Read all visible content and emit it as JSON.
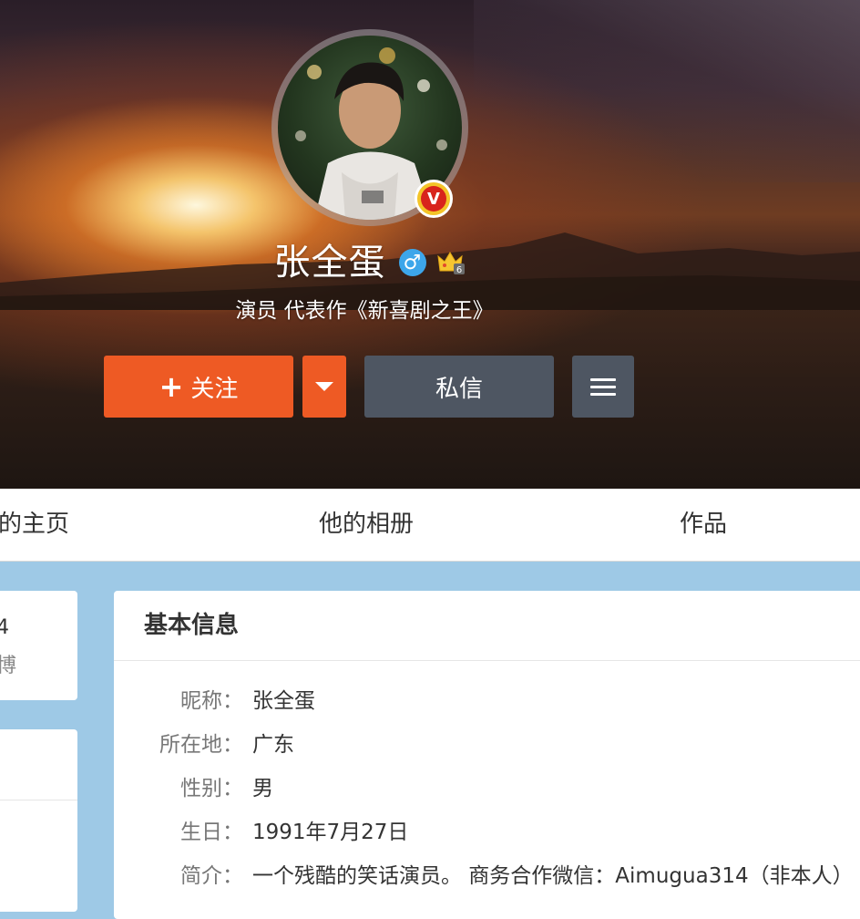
{
  "profile": {
    "name": "张全蛋",
    "bio": "演员 代表作《新喜剧之王》",
    "verified_badge": "V",
    "gender_icon": "♂",
    "colors": {
      "follow": "#ee5a24",
      "secondary": "#4e5662",
      "verified": "#d8241c",
      "gender": "#3da6ea"
    }
  },
  "actions": {
    "follow_plus": "+",
    "follow_label": "关注",
    "message_label": "私信"
  },
  "tabs": [
    {
      "label": "他的主页"
    },
    {
      "label": "他的相册"
    },
    {
      "label": "作品"
    }
  ],
  "sidebar": {
    "card1_number": "4",
    "card1_label": "博"
  },
  "basic_info": {
    "title": "基本信息",
    "rows": [
      {
        "key": "昵称：",
        "value": "张全蛋"
      },
      {
        "key": "所在地：",
        "value": "广东"
      },
      {
        "key": "性别：",
        "value": "男"
      },
      {
        "key": "生日：",
        "value": "1991年7月27日"
      },
      {
        "key": "简介：",
        "value": "一个残酷的笑话演员。 商务合作微信：Aimugua314（非本人）"
      }
    ]
  }
}
